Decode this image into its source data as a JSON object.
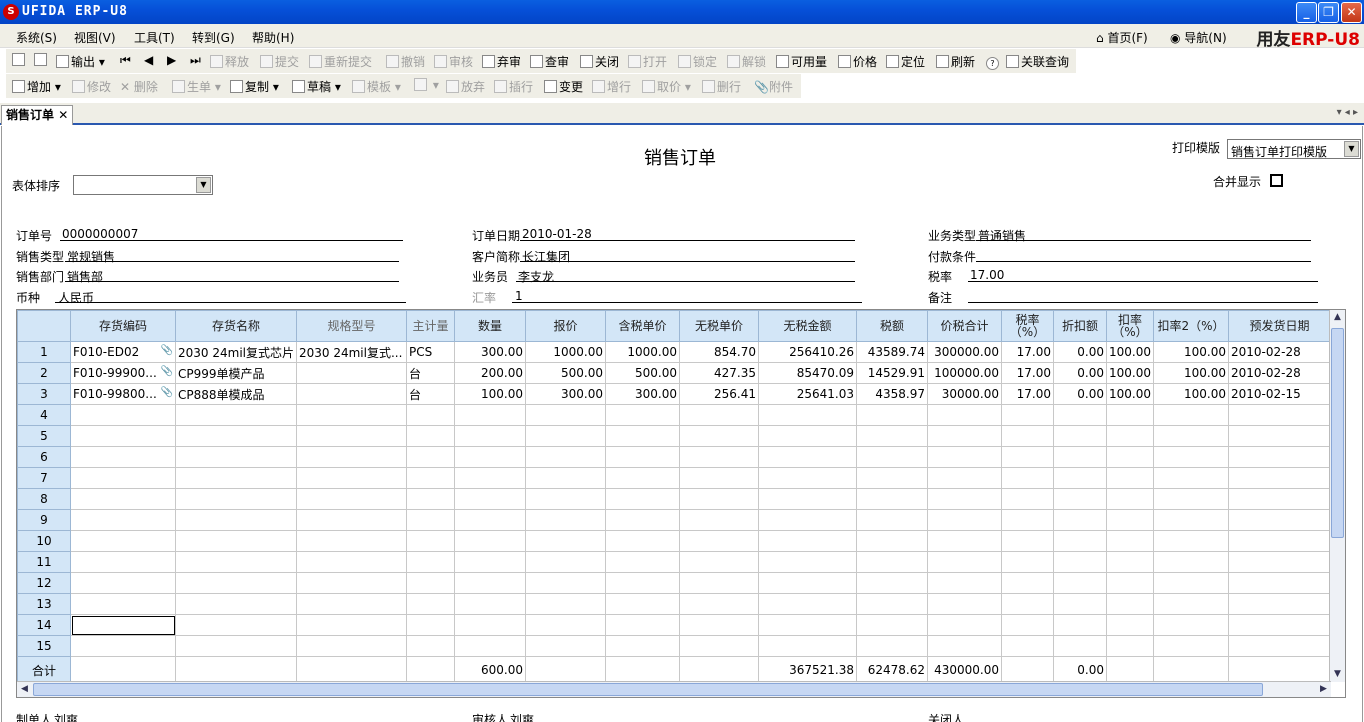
{
  "window": {
    "title": "UFIDA ERP-U8",
    "logo_glyph": "S",
    "min": "_",
    "max": "❐",
    "close": "✕"
  },
  "menu": [
    "系统(S)",
    "视图(V)",
    "工具(T)",
    "转到(G)",
    "帮助(H)"
  ],
  "top_right": {
    "home": "首页(F)",
    "nav": "导航(N)",
    "brand_a": "用友",
    "brand_b": "ERP-U8"
  },
  "toolbar1": [
    {
      "label": "",
      "icon": "print-icon",
      "enabled": true
    },
    {
      "label": "",
      "icon": "preview-icon",
      "enabled": true
    },
    {
      "label": "输出",
      "icon": "export-icon",
      "enabled": true
    },
    {
      "label": "",
      "icon": "first-icon",
      "enabled": true
    },
    {
      "label": "",
      "icon": "prev-icon",
      "enabled": true
    },
    {
      "label": "",
      "icon": "next-icon",
      "enabled": true
    },
    {
      "label": "",
      "icon": "last-icon",
      "enabled": true
    },
    {
      "label": "释放",
      "icon": "release-icon",
      "enabled": false
    },
    {
      "label": "提交",
      "icon": "submit-icon",
      "enabled": false
    },
    {
      "label": "重新提交",
      "icon": "resubmit-icon",
      "enabled": false
    },
    {
      "label": "撤销",
      "icon": "undo-icon",
      "enabled": false
    },
    {
      "label": "审核",
      "icon": "audit-icon",
      "enabled": false
    },
    {
      "label": "弃审",
      "icon": "unaudit-icon",
      "enabled": true
    },
    {
      "label": "查审",
      "icon": "check-audit-icon",
      "enabled": true
    },
    {
      "label": "关闭",
      "icon": "close-doc-icon",
      "enabled": true
    },
    {
      "label": "打开",
      "icon": "open-icon",
      "enabled": false
    },
    {
      "label": "锁定",
      "icon": "lock-icon",
      "enabled": false
    },
    {
      "label": "解锁",
      "icon": "unlock-icon",
      "enabled": false
    },
    {
      "label": "可用量",
      "icon": "available-icon",
      "enabled": true
    },
    {
      "label": "价格",
      "icon": "price-icon",
      "enabled": true
    },
    {
      "label": "定位",
      "icon": "locate-icon",
      "enabled": true
    },
    {
      "label": "刷新",
      "icon": "refresh-icon",
      "enabled": true
    },
    {
      "label": "",
      "icon": "help-icon",
      "enabled": true
    },
    {
      "label": "关联查询",
      "icon": "related-query-icon",
      "enabled": true
    }
  ],
  "toolbar2": [
    {
      "label": "增加",
      "icon": "add-icon",
      "enabled": true
    },
    {
      "label": "修改",
      "icon": "edit-icon",
      "enabled": false
    },
    {
      "label": "删除",
      "icon": "delete-icon",
      "enabled": false
    },
    {
      "label": "生单",
      "icon": "generate-icon",
      "enabled": false
    },
    {
      "label": "复制",
      "icon": "copy-icon",
      "enabled": true
    },
    {
      "label": "草稿",
      "icon": "draft-icon",
      "enabled": true
    },
    {
      "label": "模板",
      "icon": "template-icon",
      "enabled": false
    },
    {
      "label": "",
      "icon": "save-icon",
      "enabled": false
    },
    {
      "label": "放弃",
      "icon": "discard-icon",
      "enabled": false
    },
    {
      "label": "插行",
      "icon": "insert-row-icon",
      "enabled": false
    },
    {
      "label": "变更",
      "icon": "change-icon",
      "enabled": true
    },
    {
      "label": "增行",
      "icon": "add-row-icon",
      "enabled": false
    },
    {
      "label": "取价",
      "icon": "get-price-icon",
      "enabled": false
    },
    {
      "label": "删行",
      "icon": "delete-row-icon",
      "enabled": false
    },
    {
      "label": "附件",
      "icon": "attachment-icon",
      "enabled": false
    }
  ],
  "tab": {
    "label": "销售订单",
    "close": "✕",
    "nav": "▾ ◂ ▸"
  },
  "doc": {
    "title": "销售订单",
    "print_template_label": "打印模版",
    "print_template_value": "销售订单打印模版",
    "sort_label": "表体排序",
    "sort_value": "",
    "merge_label": "合并显示"
  },
  "header_fields": {
    "order_no_label": "订单号",
    "order_no": "0000000007",
    "order_date_label": "订单日期",
    "order_date": "2010-01-28",
    "biz_type_label": "业务类型",
    "biz_type": "普通销售",
    "sales_type_label": "销售类型",
    "sales_type": "常规销售",
    "customer_label": "客户简称",
    "customer": "长江集团",
    "payment_label": "付款条件",
    "payment": "",
    "dept_label": "销售部门",
    "dept": "销售部",
    "salesman_label": "业务员",
    "salesman": "李支龙",
    "tax_rate_label": "税率",
    "tax_rate": "17.00",
    "currency_label": "币种",
    "currency": "人民币",
    "exchange_label": "汇率",
    "exchange": "1",
    "remark_label": "备注",
    "remark": ""
  },
  "grid": {
    "columns": [
      "",
      "存货编码",
      "存货名称",
      "规格型号",
      "主计量",
      "数量",
      "报价",
      "含税单价",
      "无税单价",
      "无税金额",
      "税额",
      "价税合计",
      "税率（%）",
      "折扣额",
      "扣率（%）",
      "扣率2（%）",
      "预发货日期"
    ],
    "rows": [
      [
        "1",
        "F010-ED02",
        "2030 24mil复式芯片",
        "2030 24mil复式...",
        "PCS",
        "300.00",
        "1000.00",
        "1000.00",
        "854.70",
        "256410.26",
        "43589.74",
        "300000.00",
        "17.00",
        "0.00",
        "100.00",
        "100.00",
        "2010-02-28"
      ],
      [
        "2",
        "F010-99900...",
        "CP999单模产品",
        "",
        "台",
        "200.00",
        "500.00",
        "500.00",
        "427.35",
        "85470.09",
        "14529.91",
        "100000.00",
        "17.00",
        "0.00",
        "100.00",
        "100.00",
        "2010-02-28"
      ],
      [
        "3",
        "F010-99800...",
        "CP888单模成品",
        "",
        "台",
        "100.00",
        "300.00",
        "300.00",
        "256.41",
        "25641.03",
        "4358.97",
        "30000.00",
        "17.00",
        "0.00",
        "100.00",
        "100.00",
        "2010-02-15"
      ],
      [
        "4"
      ],
      [
        "5"
      ],
      [
        "6"
      ],
      [
        "7"
      ],
      [
        "8"
      ],
      [
        "9"
      ],
      [
        "10"
      ],
      [
        "11"
      ],
      [
        "12"
      ],
      [
        "13"
      ],
      [
        "14"
      ],
      [
        "15"
      ]
    ],
    "total": [
      "合计",
      "",
      "",
      "",
      "",
      "600.00",
      "",
      "",
      "",
      "367521.38",
      "62478.62",
      "430000.00",
      "",
      "0.00",
      "",
      "",
      ""
    ]
  },
  "footer": {
    "maker_label": "制单人",
    "maker": "刘爽",
    "auditor_label": "审核人",
    "auditor": "刘爽",
    "closer_label": "关闭人",
    "closer": ""
  }
}
